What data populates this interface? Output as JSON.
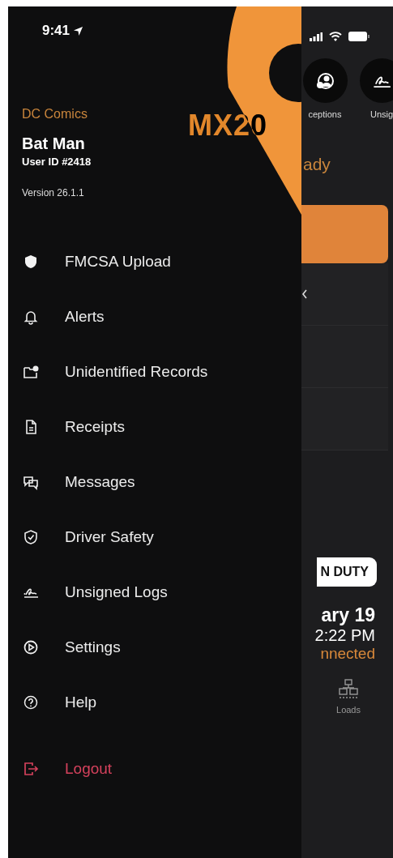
{
  "status_bar": {
    "time": "9:41"
  },
  "logo": {
    "text": "MX20"
  },
  "account": {
    "company": "DC Comics",
    "name": "Bat Man",
    "user_id": "User ID #2418",
    "version": "Version 26.1.1"
  },
  "menu": [
    {
      "label": "FMCSA Upload",
      "kind": "normal"
    },
    {
      "label": "Alerts",
      "kind": "normal"
    },
    {
      "label": "Unidentified Records",
      "kind": "normal"
    },
    {
      "label": "Receipts",
      "kind": "normal"
    },
    {
      "label": "Messages",
      "kind": "normal"
    },
    {
      "label": "Driver Safety",
      "kind": "normal"
    },
    {
      "label": "Unsigned Logs",
      "kind": "normal"
    },
    {
      "label": "Settings",
      "kind": "normal"
    },
    {
      "label": "Help",
      "kind": "normal"
    },
    {
      "label": "Logout",
      "kind": "danger"
    }
  ],
  "background_screen": {
    "shortcuts": [
      {
        "label": "ceptions"
      },
      {
        "label": "Unsig"
      }
    ],
    "heading": "ady",
    "duty_status": "N DUTY",
    "date": "ary 19",
    "time": "2:22 PM",
    "connection": "nnected",
    "tab": {
      "label": "Loads"
    }
  }
}
